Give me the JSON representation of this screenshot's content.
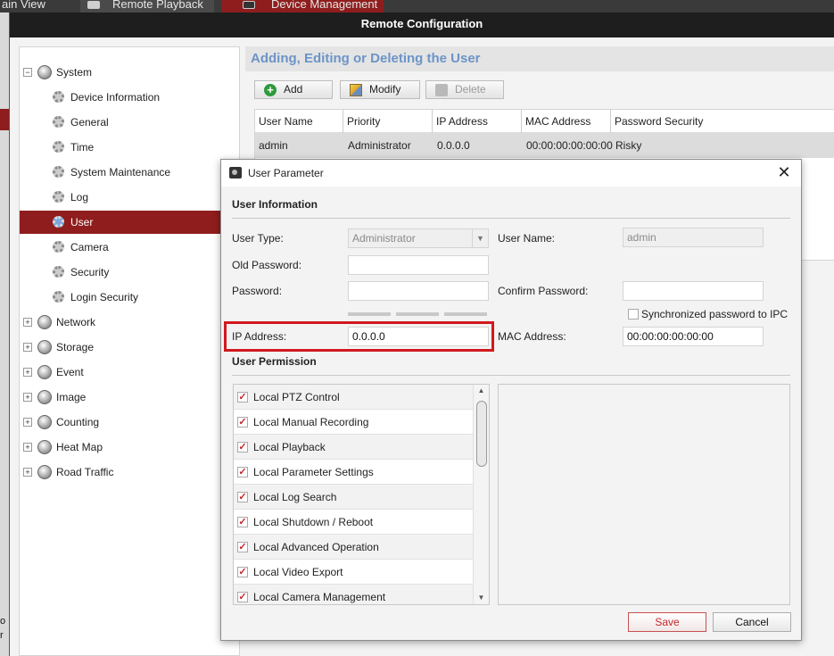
{
  "background_app": {
    "tabs": [
      {
        "label": "ain View"
      },
      {
        "label": "Remote Playback"
      },
      {
        "label": "Device Management"
      }
    ],
    "edge_text": [
      "o",
      "r"
    ]
  },
  "window": {
    "title": "Remote Configuration"
  },
  "tree": {
    "items": [
      {
        "label": "System",
        "level": "top",
        "expander": "−"
      },
      {
        "label": "Device Information",
        "level": "child"
      },
      {
        "label": "General",
        "level": "child"
      },
      {
        "label": "Time",
        "level": "child"
      },
      {
        "label": "System Maintenance",
        "level": "child"
      },
      {
        "label": "Log",
        "level": "child"
      },
      {
        "label": "User",
        "level": "child",
        "selected": true
      },
      {
        "label": "Camera",
        "level": "child"
      },
      {
        "label": "Security",
        "level": "child"
      },
      {
        "label": "Login Security",
        "level": "child"
      },
      {
        "label": "Network",
        "level": "top",
        "expander": "+"
      },
      {
        "label": "Storage",
        "level": "top",
        "expander": "+"
      },
      {
        "label": "Event",
        "level": "top",
        "expander": "+"
      },
      {
        "label": "Image",
        "level": "top",
        "expander": "+"
      },
      {
        "label": "Counting",
        "level": "top",
        "expander": "+"
      },
      {
        "label": "Heat Map",
        "level": "top",
        "expander": "+"
      },
      {
        "label": "Road Traffic",
        "level": "top",
        "expander": "+"
      }
    ]
  },
  "panel": {
    "title": "Adding, Editing or Deleting the User",
    "toolbar": {
      "add": "Add",
      "add_glyph": "+",
      "modify": "Modify",
      "delete": "Delete"
    },
    "table": {
      "columns": [
        "User Name",
        "Priority",
        "IP Address",
        "MAC Address",
        "Password Security"
      ],
      "rows": [
        [
          "admin",
          "Administrator",
          "0.0.0.0",
          "00:00:00:00:00:00",
          "Risky"
        ]
      ]
    }
  },
  "dialog": {
    "title": "User Parameter",
    "close_glyph": "✕",
    "user_info_header": "User Information",
    "user_type_label": "User Type:",
    "user_type_value": "Administrator",
    "user_name_label": "User Name:",
    "user_name_value": "admin",
    "old_password_label": "Old Password:",
    "password_label": "Password:",
    "confirm_password_label": "Confirm Password:",
    "sync_label": "Synchronized password to IPC",
    "ip_label": "IP Address:",
    "ip_value": "0.0.0.0",
    "mac_label": "MAC Address:",
    "mac_value": "00:00:00:00:00:00",
    "permission_header": "User Permission",
    "permissions": [
      {
        "label": "Local PTZ Control",
        "checked": true
      },
      {
        "label": "Local Manual Recording",
        "checked": true
      },
      {
        "label": "Local Playback",
        "checked": true
      },
      {
        "label": "Local Parameter Settings",
        "checked": true
      },
      {
        "label": "Local Log Search",
        "checked": true
      },
      {
        "label": "Local Shutdown / Reboot",
        "checked": true
      },
      {
        "label": "Local Advanced Operation",
        "checked": true
      },
      {
        "label": "Local Video Export",
        "checked": true
      },
      {
        "label": "Local Camera Management",
        "checked": true
      }
    ],
    "check_glyph": "✓",
    "save": "Save",
    "cancel": "Cancel"
  },
  "colors": {
    "accent": "#8f1d1d",
    "highlight": "#d0191f",
    "section_title": "#6c94c7"
  }
}
